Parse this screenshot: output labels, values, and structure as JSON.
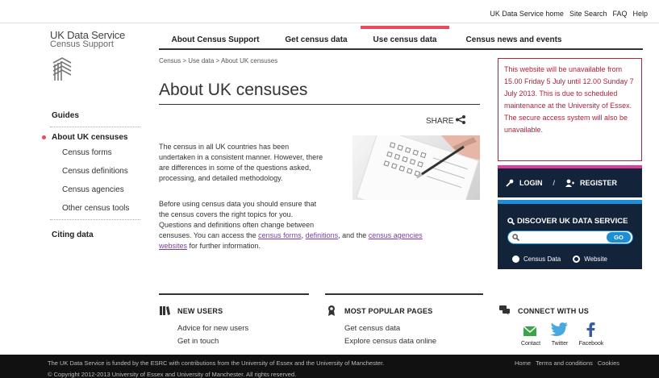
{
  "top_links": [
    "UK Data Service home",
    "Site Search",
    "FAQ",
    "Help"
  ],
  "logo": {
    "line1": "UK Data Service",
    "line2": "Census Support"
  },
  "nav": [
    {
      "label": "About Census Support",
      "active": false
    },
    {
      "label": "Get census data",
      "active": false
    },
    {
      "label": "Use census data",
      "active": true
    },
    {
      "label": "Census news and events",
      "active": false
    }
  ],
  "breadcrumb": "Census > Use data > About UK censuses",
  "page_title": "About UK censuses",
  "share_label": "SHARE",
  "sidebar": {
    "guides": "Guides",
    "current": "About UK censuses",
    "items": [
      "Census forms",
      "Census definitions",
      "Census agencies",
      "Other census tools"
    ],
    "citing": "Citing data"
  },
  "content": {
    "p1_lines": [
      "The census in all UK countries has been",
      "undertaken in a consistent manner. However, there",
      "are differences in some of the questions asked,",
      "processing, and detailed methodology."
    ],
    "p2_line1": "Before using census data you should ensure that",
    "p2_line2": "the census covers the right topics for you.",
    "p2_line3": "Questions and definitions often change between",
    "p2_l4_a": "censuses. You can access the ",
    "link_forms": "census forms",
    "comma": ", ",
    "link_definitions": "definitions",
    "p2_l4_b": ", and the ",
    "link_agencies_1": "census agencies",
    "link_agencies_2": "websites",
    "p2_l5_b": " for further information."
  },
  "alert": "This website will be unavailable from 15.00 Friday 5 July until 12.00 Sunday 7 July 2013. This is due to scheduled maintenance at the University of Essex. The secure access system will also be unavailable.",
  "login": {
    "login": "LOGIN",
    "sep": "/",
    "register": "REGISTER"
  },
  "discover": {
    "title": "DISCOVER UK DATA SERVICE",
    "go": "GO",
    "radio1": "Census Data",
    "radio2": "Website",
    "selected": "Census Data"
  },
  "footer_cols": {
    "new_users": {
      "title": "NEW USERS",
      "links": [
        "Advice for new users",
        "Get in touch"
      ]
    },
    "popular": {
      "title": "MOST POPULAR PAGES",
      "links": [
        "Get census data",
        "Explore census data online"
      ]
    },
    "connect": {
      "title": "CONNECT WITH US",
      "items": [
        "Contact",
        "Twitter",
        "Facebook"
      ]
    }
  },
  "footer": {
    "funded": "The UK Data Service is funded by the ESRC with contributions from the University of Essex and the University of Manchester.",
    "copyright": "© Copyright 2012-2013 University of Essex and University of Manchester. All rights reserved.",
    "links": [
      "Home",
      "Terms and conditions",
      "Cookies"
    ]
  },
  "colors": {
    "accent_red": "#e94b5b",
    "alert": "#b0243a",
    "navy": "#13233a",
    "pink": "#e03a9b",
    "blue": "#1d8ed6",
    "link": "#7a3fa0"
  }
}
